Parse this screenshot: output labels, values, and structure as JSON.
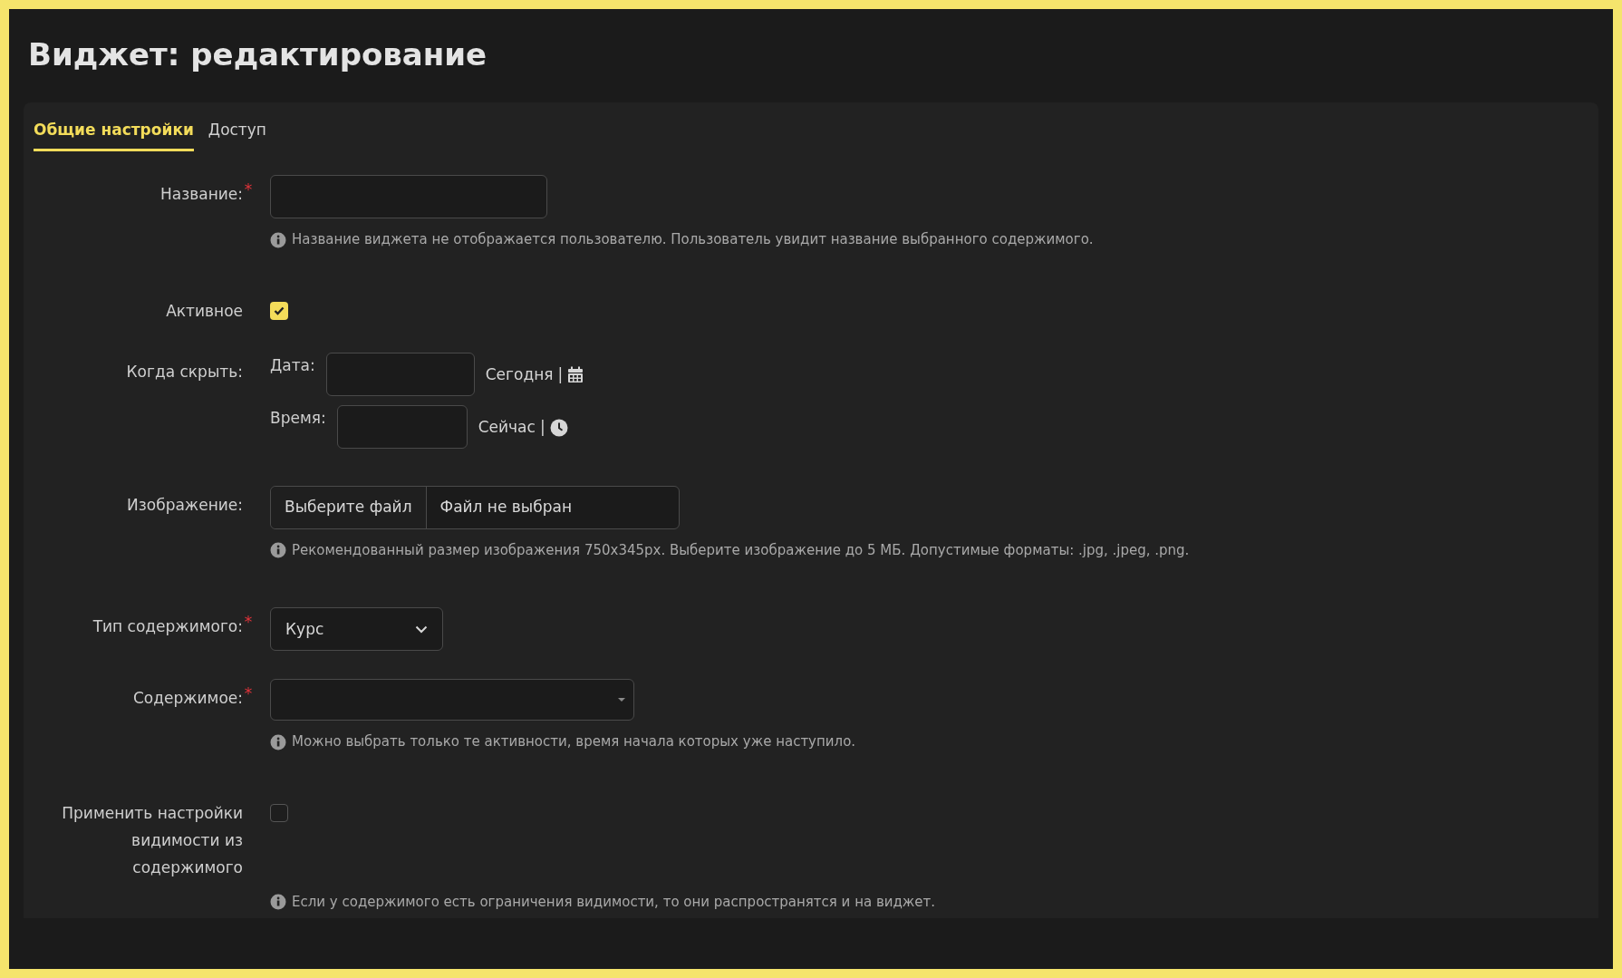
{
  "page": {
    "title": "Виджет: редактирование"
  },
  "tabs": [
    {
      "label": "Общие настройки",
      "selected": true
    },
    {
      "label": "Доступ",
      "selected": false
    }
  ],
  "fields": [
    {
      "kind": "text",
      "label": "Название:",
      "required_mark": "*",
      "hint": "Название виджета не отображается пользователю. Пользователь увидит название выбранного содержимого."
    },
    {
      "kind": "checkbox",
      "label": "Активное",
      "checked": true
    },
    {
      "kind": "datetime",
      "label": "Когда скрыть:",
      "rows": [
        {
          "kind": "date",
          "label": "Дата:",
          "link": "Сегодня",
          "separator": "|"
        },
        {
          "kind": "time",
          "label": "Время:",
          "link": "Сейчас",
          "separator": "|"
        }
      ]
    },
    {
      "kind": "file",
      "label": "Изображение:",
      "button": "Выберите файл",
      "status": "Файл не выбран",
      "hint": "Рекомендованный размер изображения 750x345px. Выберите изображение до 5 МБ. Допустимые форматы: .jpg, .jpeg, .png."
    },
    {
      "kind": "select",
      "label": "Тип содержимого:",
      "required_mark": "*",
      "value": "Курс"
    },
    {
      "kind": "combobox",
      "label": "Содержимое:",
      "required_mark": "*",
      "hint": "Можно выбрать только те активности, время начала которых уже наступило."
    },
    {
      "kind": "checkbox",
      "label": "Применить настройки видимости из содержимого",
      "checked": false,
      "hint": "Если у содержимого есть ограничения видимости, то они распространятся и на виджет."
    }
  ]
}
